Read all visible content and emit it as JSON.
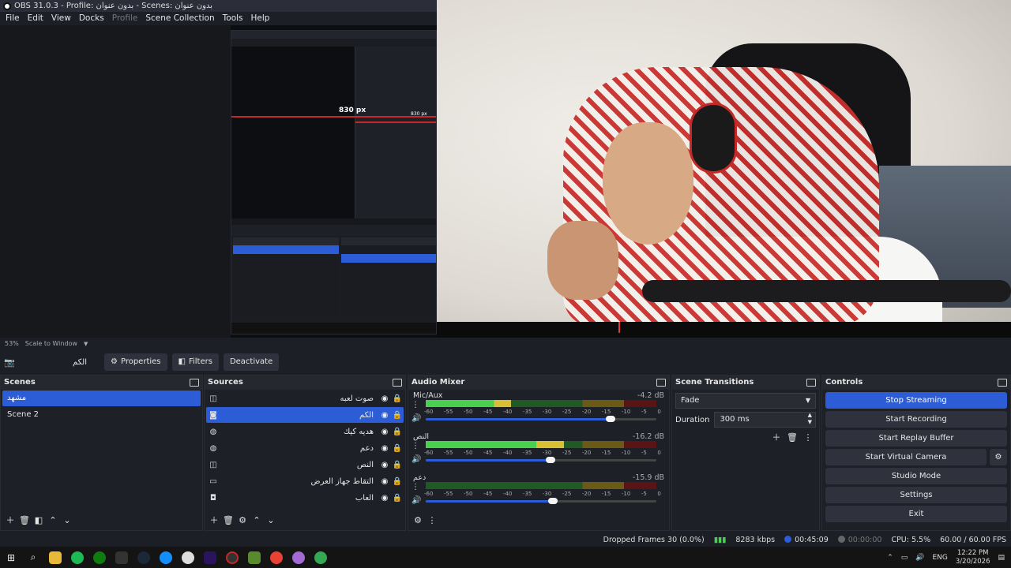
{
  "window": {
    "title": "OBS 31.0.3 - Profile: بدون عنوان - Scenes: بدون عنوان"
  },
  "menu": [
    "File",
    "Edit",
    "View",
    "Docks",
    "Profile",
    "Scene Collection",
    "Tools",
    "Help"
  ],
  "preview": {
    "measure_label": "830 px"
  },
  "zoom": {
    "percent": "53%",
    "mode": "Scale to Window"
  },
  "source_toolbar": {
    "selected_source": "الكم",
    "properties": "Properties",
    "filters": "Filters",
    "deactivate": "Deactivate"
  },
  "scenes": {
    "title": "Scenes",
    "items": [
      "مشهد",
      "Scene 2"
    ],
    "selected_index": 0
  },
  "sources": {
    "title": "Sources",
    "items": [
      {
        "name": "صوت لعبه",
        "type_icon": "audio-output-icon"
      },
      {
        "name": "الكم",
        "type_icon": "camera-icon"
      },
      {
        "name": "هديه كيك",
        "type_icon": "browser-icon"
      },
      {
        "name": "دعم",
        "type_icon": "browser-icon"
      },
      {
        "name": "النص",
        "type_icon": "text-icon"
      },
      {
        "name": "التقاط جهاز العرض",
        "type_icon": "display-icon"
      },
      {
        "name": "العاب",
        "type_icon": "game-icon"
      }
    ],
    "selected_index": 1
  },
  "mixer": {
    "title": "Audio Mixer",
    "ticks": [
      "-60",
      "-55",
      "-50",
      "-45",
      "-40",
      "-35",
      "-30",
      "-25",
      "-20",
      "-15",
      "-10",
      "-5",
      "0"
    ],
    "channels": [
      {
        "name": "Mic/Aux",
        "db": "-4.2 dB",
        "level": 0.37,
        "volume": 0.8
      },
      {
        "name": "النص",
        "db": "-16.2 dB",
        "level": 0.6,
        "volume": 0.54
      },
      {
        "name": "دعم",
        "db": "-15.9 dB",
        "level": 0.0,
        "volume": 0.55
      }
    ]
  },
  "transitions": {
    "title": "Scene Transitions",
    "selected": "Fade",
    "duration_label": "Duration",
    "duration_value": "300 ms"
  },
  "controls": {
    "title": "Controls",
    "buttons": [
      "Stop Streaming",
      "Start Recording",
      "Start Replay Buffer",
      "Start Virtual Camera",
      "Studio Mode",
      "Settings",
      "Exit"
    ]
  },
  "status": {
    "dropped": "Dropped Frames 30 (0.0%)",
    "bitrate": "8283 kbps",
    "stream_time": "00:45:09",
    "record_time": "00:00:00",
    "cpu": "CPU: 5.5%",
    "fps": "60.00 / 60.00 FPS"
  },
  "taskbar": {
    "lang": "ENG",
    "time": "12:22 PM",
    "date": "3/20/2026"
  },
  "colors": {
    "accent": "#2c5cd6",
    "bg": "#1d1f26",
    "meter_green": "#48d14f",
    "meter_yellow": "#d8c035",
    "meter_red": "#8c1c1f"
  }
}
